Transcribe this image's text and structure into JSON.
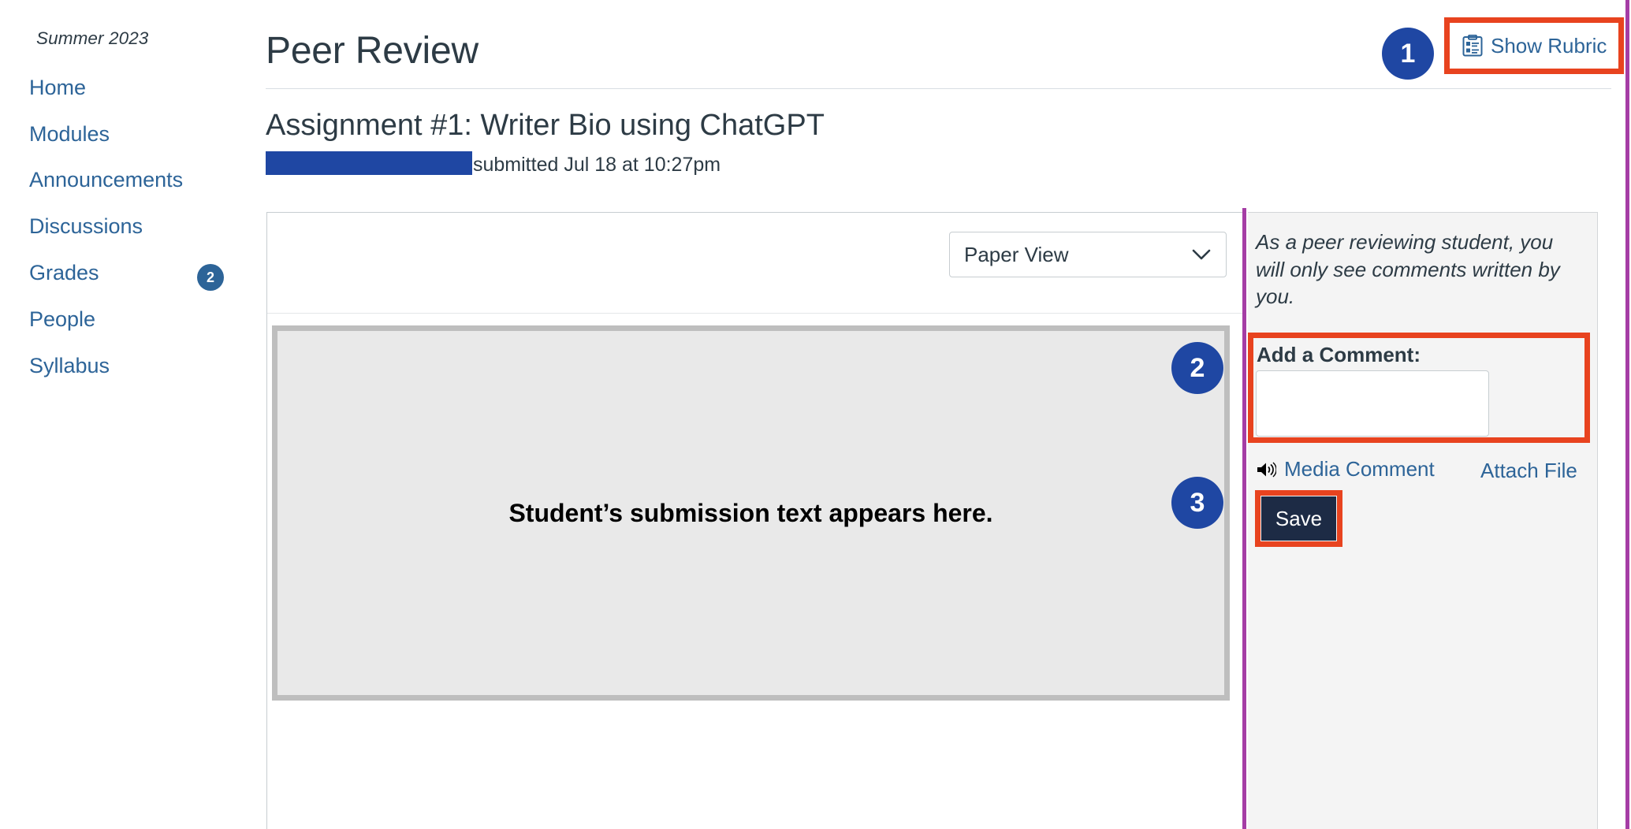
{
  "sidebar": {
    "term": "Summer 2023",
    "items": [
      {
        "label": "Home"
      },
      {
        "label": "Modules"
      },
      {
        "label": "Announcements"
      },
      {
        "label": "Discussions"
      },
      {
        "label": "Grades",
        "badge": "2"
      },
      {
        "label": "People"
      },
      {
        "label": "Syllabus"
      }
    ]
  },
  "header": {
    "title": "Peer Review",
    "show_rubric_label": "Show Rubric",
    "show_rubric_icon": "rubric-clipboard-icon"
  },
  "assignment": {
    "title": "Assignment #1: Writer Bio using ChatGPT",
    "student_name_redacted": "",
    "submitted_text": "submitted Jul 18 at 10:27pm"
  },
  "submission": {
    "view_select_value": "Paper View",
    "view_select_icon": "chevron-down-icon",
    "body_text": "Student’s submission text appears here."
  },
  "comments": {
    "peer_note": "As a peer reviewing student, you will only see comments written by you.",
    "add_comment_label": "Add a Comment:",
    "comment_value": "",
    "comment_placeholder": "",
    "media_comment_label": "Media Comment",
    "media_comment_icon": "speaker-icon",
    "attach_file_label": "Attach File",
    "save_label": "Save"
  },
  "annotations": {
    "step_1": "1",
    "step_2": "2",
    "step_3": "3"
  },
  "colors": {
    "link_blue": "#2d6498",
    "badge_navy": "#1f47a3",
    "highlight_orange": "#e8431f",
    "divider_purple": "#a53da5",
    "save_navy": "#1d2b45",
    "text_dark": "#2d3b45"
  }
}
